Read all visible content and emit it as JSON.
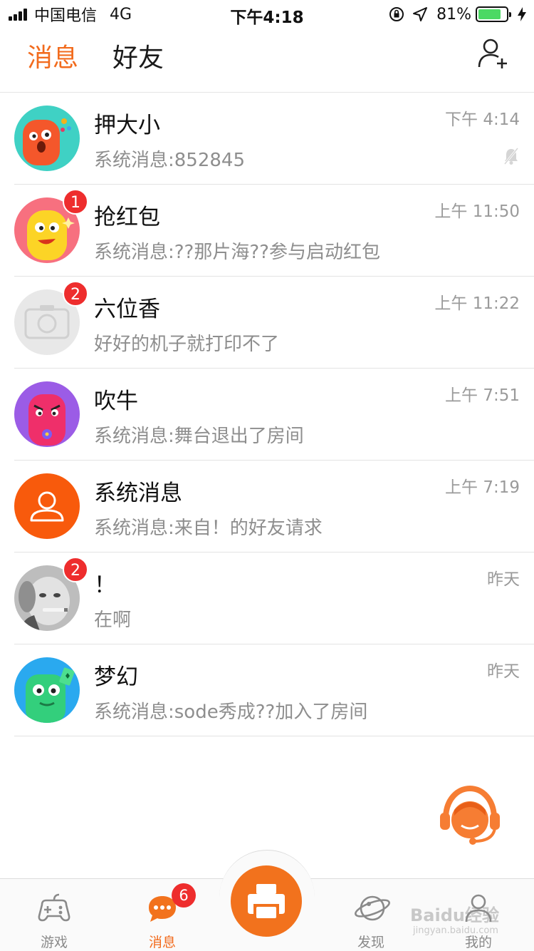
{
  "status_bar": {
    "carrier": "中国电信",
    "network": "4G",
    "time": "下午4:18",
    "battery_percent": "81%",
    "battery_level": 0.81
  },
  "header": {
    "tab_messages": "消息",
    "tab_friends": "好友",
    "add_friend_icon": "add-user-icon"
  },
  "chats": [
    {
      "name": "押大小",
      "preview": "系统消息:852845",
      "time": "下午 4:14",
      "badge": "",
      "muted": true,
      "avatar": "orange-monster"
    },
    {
      "name": "抢红包",
      "preview": "系统消息:??那片海??参与启动红包",
      "time": "上午 11:50",
      "badge": "1",
      "muted": false,
      "avatar": "yellow-monster"
    },
    {
      "name": "六位香",
      "preview": "好好的机子就打印不了",
      "time": "上午 11:22",
      "badge": "2",
      "muted": false,
      "avatar": "camera-placeholder"
    },
    {
      "name": "吹牛",
      "preview": "系统消息:舞台退出了房间",
      "time": "上午 7:51",
      "badge": "",
      "muted": false,
      "avatar": "pink-monster"
    },
    {
      "name": "系统消息",
      "preview": "系统消息:来自！的好友请求",
      "time": "上午 7:19",
      "badge": "",
      "muted": false,
      "avatar": "system-user"
    },
    {
      "name": "！",
      "preview": "在啊",
      "time": "昨天",
      "badge": "2",
      "muted": false,
      "avatar": "baby-photo"
    },
    {
      "name": "梦幻",
      "preview": "系统消息:sode秀成??加入了房间",
      "time": "昨天",
      "badge": "",
      "muted": false,
      "avatar": "green-monster"
    }
  ],
  "tab_bar": {
    "games": "游戏",
    "messages": "消息",
    "messages_badge": "6",
    "discover": "发现",
    "mine": "我的"
  },
  "watermark": {
    "text": "Baidu经验",
    "sub": "jingyan.baidu.com"
  },
  "colors": {
    "accent": "#f26b1d",
    "badge": "#ee2d2d"
  }
}
